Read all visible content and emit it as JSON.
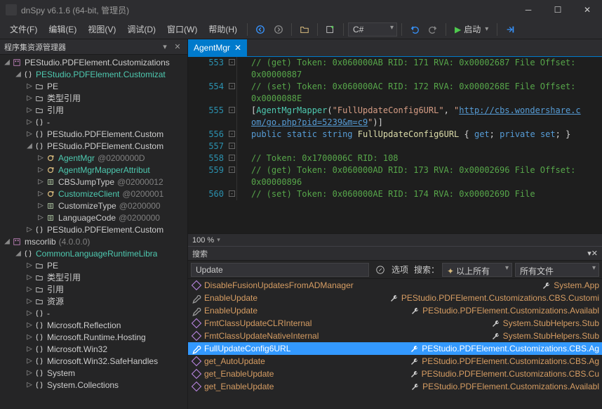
{
  "title": "dnSpy v6.1.6 (64-bit, 管理员)",
  "menus": [
    "文件(F)",
    "编辑(E)",
    "视图(V)",
    "调试(D)",
    "窗口(W)",
    "帮助(H)"
  ],
  "lang_combo": "C#",
  "run_label": "启动",
  "assembly_explorer": {
    "title": "程序集资源管理器",
    "nodes": [
      {
        "depth": 0,
        "exp": "◢",
        "icon": "asm",
        "label": "PEStudio.PDFElement.Customizations",
        "cls": "",
        "suffix": ""
      },
      {
        "depth": 1,
        "exp": "◢",
        "icon": "ns",
        "label": "PEStudio.PDFElement.Customizat",
        "cls": "cyan",
        "suffix": ""
      },
      {
        "depth": 2,
        "exp": "▷",
        "icon": "folder",
        "label": "PE",
        "cls": "",
        "suffix": ""
      },
      {
        "depth": 2,
        "exp": "▷",
        "icon": "folder",
        "label": "类型引用",
        "cls": "",
        "suffix": ""
      },
      {
        "depth": 2,
        "exp": "▷",
        "icon": "folder",
        "label": "引用",
        "cls": "",
        "suffix": ""
      },
      {
        "depth": 2,
        "exp": "▷",
        "icon": "ns",
        "label": "-",
        "cls": "",
        "suffix": ""
      },
      {
        "depth": 2,
        "exp": "▷",
        "icon": "ns",
        "label": "PEStudio.PDFElement.Custom",
        "cls": "",
        "suffix": ""
      },
      {
        "depth": 2,
        "exp": "◢",
        "icon": "ns",
        "label": "PEStudio.PDFElement.Custom",
        "cls": "",
        "suffix": ""
      },
      {
        "depth": 3,
        "exp": "▷",
        "icon": "class",
        "label": "AgentMgr",
        "cls": "cyan",
        "suffix": "@0200000D"
      },
      {
        "depth": 3,
        "exp": "▷",
        "icon": "class",
        "label": "AgentMgrMapperAttribut",
        "cls": "cyan",
        "suffix": ""
      },
      {
        "depth": 3,
        "exp": "▷",
        "icon": "enum",
        "label": "CBSJumpType",
        "cls": "",
        "suffix": "@02000012"
      },
      {
        "depth": 3,
        "exp": "▷",
        "icon": "class",
        "label": "CustomizeClient",
        "cls": "cyan",
        "suffix": "@0200001"
      },
      {
        "depth": 3,
        "exp": "▷",
        "icon": "enum",
        "label": "CustomizeType",
        "cls": "",
        "suffix": "@0200000"
      },
      {
        "depth": 3,
        "exp": "▷",
        "icon": "enum",
        "label": "LanguageCode",
        "cls": "",
        "suffix": "@0200000"
      },
      {
        "depth": 2,
        "exp": "▷",
        "icon": "ns",
        "label": "PEStudio.PDFElement.Custom",
        "cls": "",
        "suffix": ""
      },
      {
        "depth": 0,
        "exp": "◢",
        "icon": "asm",
        "label": "mscorlib",
        "cls": "",
        "suffix": "(4.0.0.0)"
      },
      {
        "depth": 1,
        "exp": "◢",
        "icon": "ns",
        "label": "CommonLanguageRuntimeLibra",
        "cls": "cyan",
        "suffix": ""
      },
      {
        "depth": 2,
        "exp": "▷",
        "icon": "folder",
        "label": "PE",
        "cls": "",
        "suffix": ""
      },
      {
        "depth": 2,
        "exp": "▷",
        "icon": "folder",
        "label": "类型引用",
        "cls": "",
        "suffix": ""
      },
      {
        "depth": 2,
        "exp": "▷",
        "icon": "folder",
        "label": "引用",
        "cls": "",
        "suffix": ""
      },
      {
        "depth": 2,
        "exp": "▷",
        "icon": "folder",
        "label": "资源",
        "cls": "",
        "suffix": ""
      },
      {
        "depth": 2,
        "exp": "▷",
        "icon": "ns",
        "label": "-",
        "cls": "",
        "suffix": ""
      },
      {
        "depth": 2,
        "exp": "▷",
        "icon": "ns",
        "label": "Microsoft.Reflection",
        "cls": "",
        "suffix": ""
      },
      {
        "depth": 2,
        "exp": "▷",
        "icon": "ns",
        "label": "Microsoft.Runtime.Hosting",
        "cls": "",
        "suffix": ""
      },
      {
        "depth": 2,
        "exp": "▷",
        "icon": "ns",
        "label": "Microsoft.Win32",
        "cls": "",
        "suffix": ""
      },
      {
        "depth": 2,
        "exp": "▷",
        "icon": "ns",
        "label": "Microsoft.Win32.SafeHandles",
        "cls": "",
        "suffix": ""
      },
      {
        "depth": 2,
        "exp": "▷",
        "icon": "ns",
        "label": "System",
        "cls": "",
        "suffix": ""
      },
      {
        "depth": 2,
        "exp": "▷",
        "icon": "ns",
        "label": "System.Collections",
        "cls": "",
        "suffix": ""
      }
    ]
  },
  "editor": {
    "tab": "AgentMgr",
    "zoom": "100 %",
    "lines": [
      {
        "n": "553",
        "html": "<span class='c-comment'>// (get) Token: 0x060000AB RID: 171 RVA: 0x00002687 File Offset: 0x00000887</span>"
      },
      {
        "n": "554",
        "html": "<span class='c-comment'>// (set) Token: 0x060000AC RID: 172 RVA: 0x0000268E File Offset: 0x0000088E</span>"
      },
      {
        "n": "555",
        "html": "<span class='c-punc'>[</span><span class='c-attr'>AgentMgrMapper</span><span class='c-punc'>(</span><span class='c-string'>\"FullUpdateConfig6URL\"</span><span class='c-punc'>, </span><span class='c-string'>\"<span class='c-url'>http://cbs.wondershare.com/go.php?pid=5239&m=c9</span>\"</span><span class='c-punc'>)]</span>"
      },
      {
        "n": "556",
        "html": "<span class='c-keyword'>public</span> <span class='c-keyword'>static</span> <span class='c-keyword'>string</span> <span class='c-method'>FullUpdateConfig6URL</span> <span class='c-punc'>{</span> <span class='c-keyword'>get</span><span class='c-punc'>;</span> <span class='c-keyword'>private set</span><span class='c-punc'>; }</span>"
      },
      {
        "n": "557",
        "html": ""
      },
      {
        "n": "558",
        "html": "<span class='c-comment'>// Token: 0x1700006C RID: 108</span>"
      },
      {
        "n": "559",
        "html": "<span class='c-comment'>// (get) Token: 0x060000AD RID: 173 RVA: 0x00002696 File Offset: 0x00000896</span>"
      },
      {
        "n": "560",
        "html": "<span class='c-comment'>// (set) Token: 0x060000AE RID: 174 RVA: 0x0000269D File</span>"
      }
    ]
  },
  "search": {
    "title": "搜索",
    "query": "Update",
    "opt_label": "选项",
    "search_label": "搜索：",
    "scope1": "以上所有",
    "scope2": "所有文件",
    "results": [
      {
        "icon": "method",
        "name": "DisableFusionUpdatesFromADManager",
        "loc": "System.App",
        "sel": false
      },
      {
        "icon": "prop",
        "name": "EnableUpdate",
        "loc": "PEStudio.PDFElement.Customizations.CBS.Customi",
        "sel": false
      },
      {
        "icon": "prop",
        "name": "EnableUpdate",
        "loc": "PEStudio.PDFElement.Customizations.Availabl",
        "sel": false
      },
      {
        "icon": "method",
        "name": "FmtClassUpdateCLRInternal",
        "loc": "System.StubHelpers.Stub",
        "sel": false
      },
      {
        "icon": "method",
        "name": "FmtClassUpdateNativeInternal",
        "loc": "System.StubHelpers.Stub",
        "sel": false
      },
      {
        "icon": "prop",
        "name": "FullUpdateConfig6URL",
        "loc": "PEStudio.PDFElement.Customizations.CBS.Ag",
        "sel": true
      },
      {
        "icon": "method",
        "name": "get_AutoUpdate",
        "loc": "PEStudio.PDFElement.Customizations.CBS.Ag",
        "sel": false
      },
      {
        "icon": "method",
        "name": "get_EnableUpdate",
        "loc": "PEStudio.PDFElement.Customizations.CBS.Cu",
        "sel": false
      },
      {
        "icon": "method",
        "name": "get_EnableUpdate",
        "loc": "PEStudio.PDFElement.Customizations.Availabl",
        "sel": false
      }
    ]
  }
}
